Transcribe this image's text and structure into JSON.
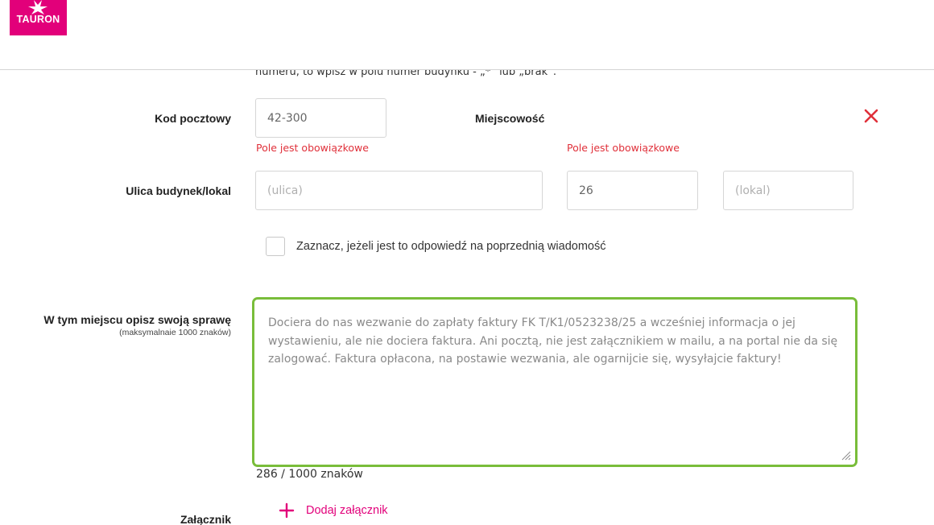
{
  "brand": {
    "name": "TAURON",
    "color": "#e2007a"
  },
  "form": {
    "truncated_hint": "numeru, to wpisz w polu numer budynku - „*” lub „brak”.",
    "postal": {
      "label": "Kod pocztowy",
      "value": "42-300",
      "error": "Pole jest obowiązkowe"
    },
    "city": {
      "label": "Miejscowość",
      "error": "Pole jest obowiązkowe",
      "clear_icon": "close-icon"
    },
    "street": {
      "label": "Ulica budynek/lokal",
      "street_placeholder": "(ulica)",
      "building_value": "26",
      "unit_placeholder": "(lokal)"
    },
    "reply_checkbox": {
      "label": "Zaznacz, jeżeli jest to odpowiedź na poprzednią wiadomość",
      "checked": false
    },
    "description": {
      "label": "W tym miejscu opisz swoją sprawę",
      "sublabel": "(maksymalnaie 1000 znaków)",
      "value": "Dociera do nas wezwanie do zapłaty faktury FK T/K1/0523238/25 a wcześniej informacja o jej wystawieniu, ale nie dociera faktura. Ani pocztą, nie jest załącznikiem w mailu, a na portal nie da się zalogować. Faktura opłacona, na postawie wezwania, ale ogarnijcie się, wysyłajcie faktury!",
      "counter": "286 / 1000 znaków",
      "accent_color": "#79bd3a"
    },
    "attachment": {
      "label": "Załącznik",
      "button_label": "Dodaj załącznik",
      "icon": "plus-icon"
    },
    "error_color": "#e0303a"
  }
}
